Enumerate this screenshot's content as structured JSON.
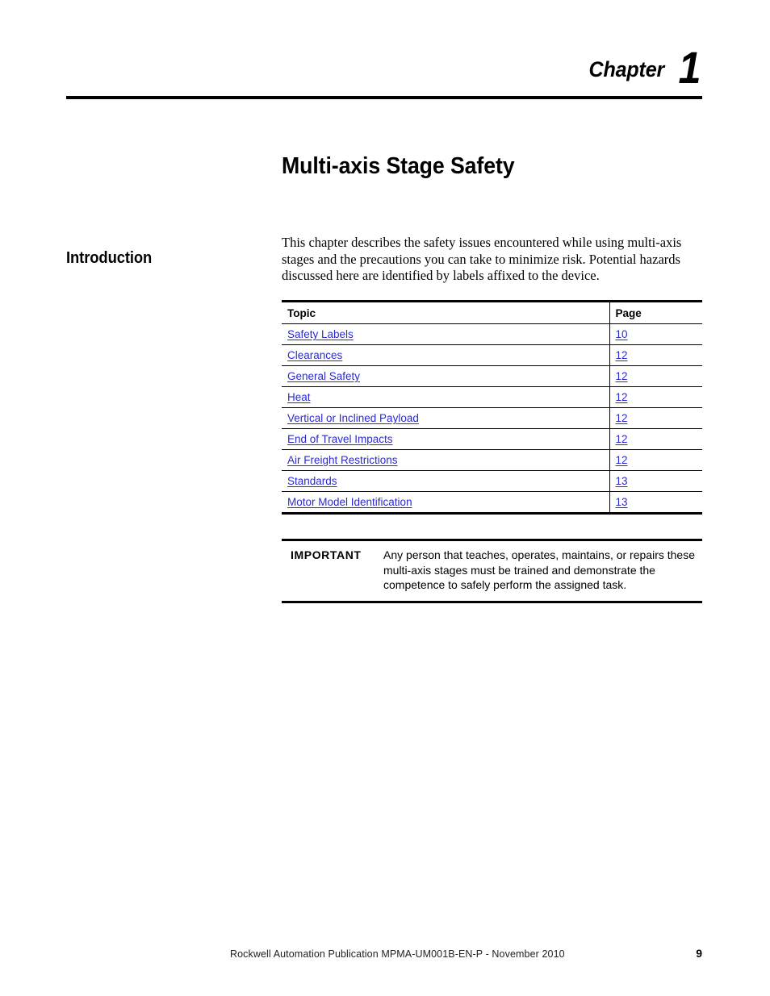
{
  "header": {
    "chapter_word": "Chapter",
    "chapter_number": "1"
  },
  "title": "Multi-axis Stage Safety",
  "section": {
    "heading": "Introduction",
    "paragraph": "This chapter describes the safety issues encountered while using multi-axis stages and the precautions you can take to minimize risk. Potential hazards discussed here are identified by labels affixed to the device."
  },
  "topic_table": {
    "columns": [
      "Topic",
      "Page"
    ],
    "rows": [
      {
        "topic": "Safety Labels",
        "page": "10"
      },
      {
        "topic": "Clearances",
        "page": "12"
      },
      {
        "topic": "General Safety",
        "page": "12"
      },
      {
        "topic": "Heat",
        "page": "12"
      },
      {
        "topic": "Vertical or Inclined Payload",
        "page": "12"
      },
      {
        "topic": "End of Travel Impacts",
        "page": "12"
      },
      {
        "topic": "Air Freight Restrictions",
        "page": "12"
      },
      {
        "topic": "Standards",
        "page": "13"
      },
      {
        "topic": "Motor Model Identification",
        "page": "13"
      }
    ]
  },
  "important": {
    "label": "IMPORTANT",
    "text": "Any person that teaches, operates, maintains, or repairs these multi-axis stages must be trained and demonstrate the competence to safely perform the assigned task."
  },
  "footer": {
    "publication": "Rockwell Automation Publication MPMA-UM001B-EN-P - November 2010",
    "page_number": "9"
  },
  "colors": {
    "link": "#2a2ad0",
    "rule": "#000000",
    "background": "#ffffff"
  }
}
